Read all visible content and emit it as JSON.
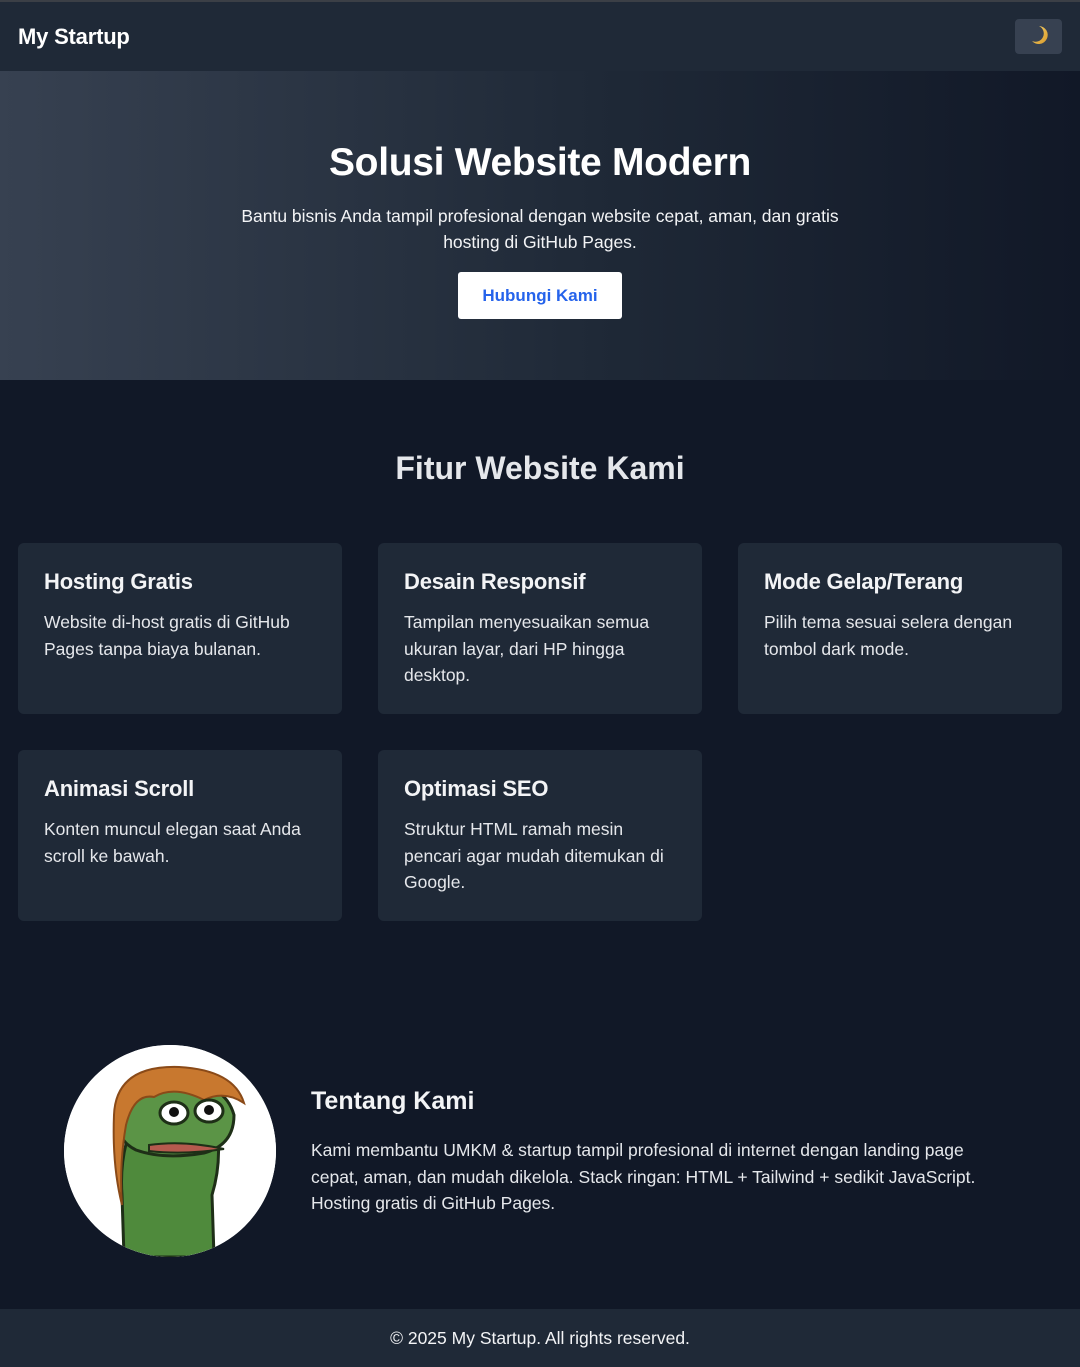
{
  "header": {
    "brand": "My Startup",
    "theme_toggle_icon": "moon-icon"
  },
  "hero": {
    "title": "Solusi Website Modern",
    "subtitle": "Bantu bisnis Anda tampil profesional dengan website cepat, aman, dan gratis hosting di GitHub Pages.",
    "cta_label": "Hubungi Kami"
  },
  "features": {
    "title": "Fitur Website Kami",
    "items": [
      {
        "title": "Hosting Gratis",
        "text": "Website di-host gratis di GitHub Pages tanpa biaya bulanan."
      },
      {
        "title": "Desain Responsif",
        "text": "Tampilan menyesuaikan semua ukuran layar, dari HP hingga desktop."
      },
      {
        "title": "Mode Gelap/Terang",
        "text": "Pilih tema sesuai selera dengan tombol dark mode."
      },
      {
        "title": "Animasi Scroll",
        "text": "Konten muncul elegan saat Anda scroll ke bawah."
      },
      {
        "title": "Optimasi SEO",
        "text": "Struktur HTML ramah mesin pencari agar mudah ditemukan di Google."
      }
    ]
  },
  "about": {
    "title": "Tentang Kami",
    "text": "Kami membantu UMKM & startup tampil profesional di internet dengan landing page cepat, aman, dan mudah dikelola. Stack ringan: HTML + Tailwind + sedikit JavaScript. Hosting gratis di GitHub Pages."
  },
  "footer": {
    "text": "© 2025 My Startup. All rights reserved."
  },
  "colors": {
    "page_bg": "#111827",
    "surface": "#1f2937",
    "button_text": "#2563eb"
  }
}
